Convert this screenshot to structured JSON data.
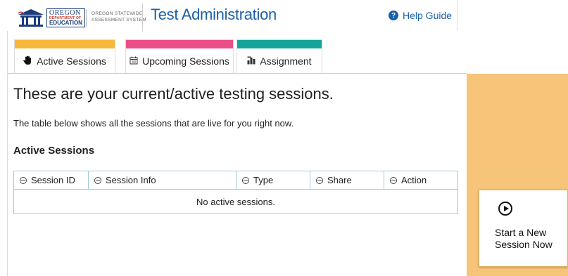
{
  "header": {
    "logo": {
      "line1": "OREGON",
      "line2": "DEPARTMENT OF",
      "line3": "EDUCATION"
    },
    "system_name_line1": "OREGON STATEWIDE",
    "system_name_line2": "ASSESSMENT SYSTEM",
    "app_title": "Test Administration",
    "help_label": "Help Guide"
  },
  "tabs": [
    {
      "label": "Active Sessions",
      "icon": "hand-icon",
      "color": "#f6b93b"
    },
    {
      "label": "Upcoming Sessions",
      "icon": "calendar-icon",
      "color": "#ea4e87"
    },
    {
      "label": "Assignment",
      "icon": "chart-icon",
      "color": "#16a49a"
    }
  ],
  "main": {
    "title": "These are your current/active testing sessions.",
    "description": "The table below shows all the sessions that are live for you right now.",
    "section_title": "Active Sessions",
    "table": {
      "columns": [
        "Session ID",
        "Session Info",
        "Type",
        "Share",
        "Action"
      ],
      "empty_message": "No active sessions."
    }
  },
  "side_panel": {
    "background": "#f7c57a",
    "start_label_line1": "Start a New",
    "start_label_line2": "Session Now"
  }
}
